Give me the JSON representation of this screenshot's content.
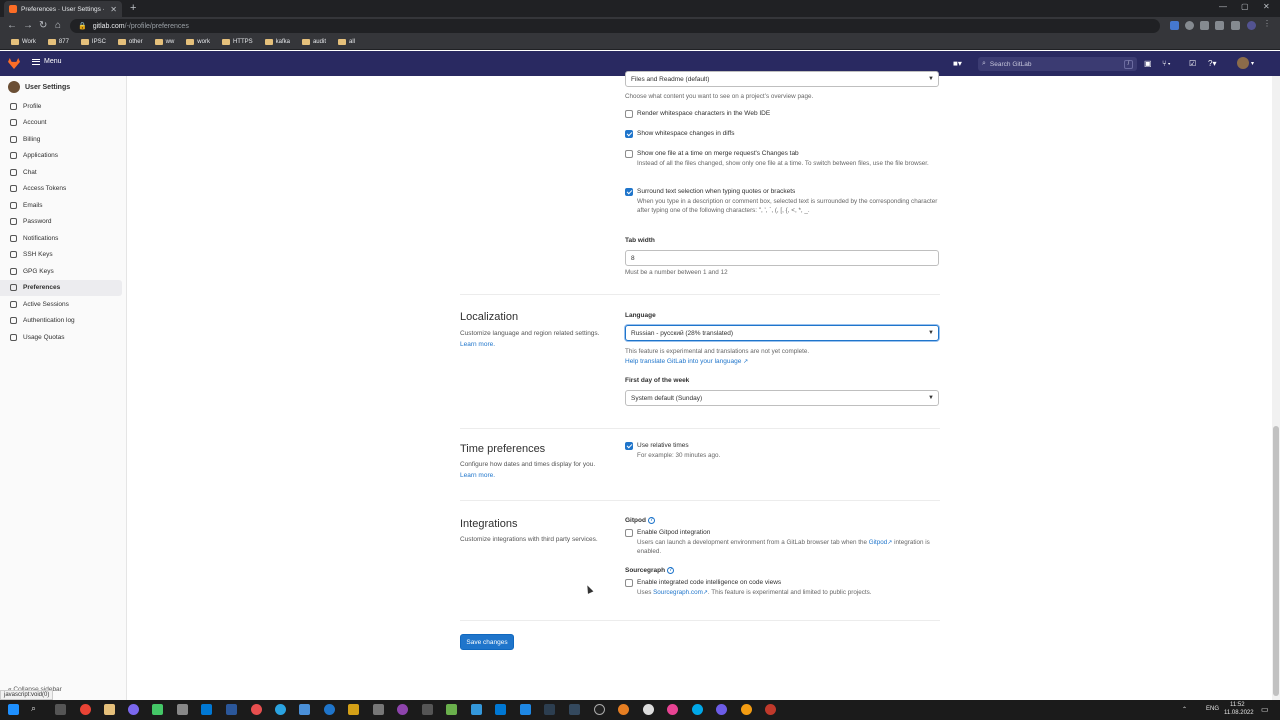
{
  "browser": {
    "tab_title": "Preferences · User Settings · GitL",
    "url_host": "gitlab.com",
    "url_path": "/-/profile/preferences",
    "bookmarks": [
      "Work",
      "877",
      "IPSC",
      "other",
      "ww",
      "work",
      "HTTPS",
      "kafka",
      "audit",
      "all"
    ]
  },
  "header": {
    "menu_label": "Menu",
    "search_placeholder": "Search GitLab",
    "search_shortcut": "/"
  },
  "sidebar": {
    "title": "User Settings",
    "items": [
      {
        "label": "Profile",
        "icon": "user-icon"
      },
      {
        "label": "Account",
        "icon": "account-icon"
      },
      {
        "label": "Billing",
        "icon": "credit-card-icon"
      },
      {
        "label": "Applications",
        "icon": "applications-icon"
      },
      {
        "label": "Chat",
        "icon": "chat-icon"
      },
      {
        "label": "Access Tokens",
        "icon": "token-icon"
      },
      {
        "label": "Emails",
        "icon": "mail-icon"
      },
      {
        "label": "Password",
        "icon": "lock-icon"
      },
      {
        "label": "Notifications",
        "icon": "notifications-icon"
      },
      {
        "label": "SSH Keys",
        "icon": "key-icon"
      },
      {
        "label": "GPG Keys",
        "icon": "key-icon"
      },
      {
        "label": "Preferences",
        "icon": "preferences-icon"
      },
      {
        "label": "Active Sessions",
        "icon": "monitor-icon"
      },
      {
        "label": "Authentication log",
        "icon": "log-icon"
      },
      {
        "label": "Usage Quotas",
        "icon": "quota-icon"
      }
    ],
    "active_index": 11,
    "collapse_label": "Collapse sidebar",
    "status_url": "javascript:void(0)"
  },
  "behavior": {
    "overview_select_value": "Files and Readme (default)",
    "overview_help": "Choose what content you want to see on a project’s overview page.",
    "render_whitespace_label": "Render whitespace characters in the Web IDE",
    "render_whitespace_checked": false,
    "show_whitespace_label": "Show whitespace changes in diffs",
    "show_whitespace_checked": true,
    "one_file_label": "Show one file at a time on merge request's Changes tab",
    "one_file_checked": false,
    "one_file_help": "Instead of all the files changed, show only one file at a time. To switch between files, use the file browser.",
    "surround_label": "Surround text selection when typing quotes or brackets",
    "surround_checked": true,
    "surround_help": "When you type in a description or comment box, selected text is surrounded by the corresponding character after typing one of the following characters: \", ', `, (, [, {, <, *, _.",
    "tab_width_label": "Tab width",
    "tab_width_value": "8",
    "tab_width_help": "Must be a number between 1 and 12"
  },
  "localization": {
    "title": "Localization",
    "desc": "Customize language and region related settings.",
    "learn_more": "Learn more.",
    "language_label": "Language",
    "language_value": "Russian - русский (28% translated)",
    "language_help": "This feature is experimental and translations are not yet complete.",
    "help_translate": "Help translate GitLab into your language",
    "first_day_label": "First day of the week",
    "first_day_value": "System default (Sunday)"
  },
  "time_preferences": {
    "title": "Time preferences",
    "desc": "Configure how dates and times display for you.",
    "learn_more": "Learn more.",
    "relative_label": "Use relative times",
    "relative_checked": true,
    "relative_help": "For example: 30 minutes ago."
  },
  "integrations": {
    "title": "Integrations",
    "desc": "Customize integrations with third party services.",
    "gitpod_label": "Gitpod",
    "gitpod_enable": "Enable Gitpod integration",
    "gitpod_checked": false,
    "gitpod_help_pre": "Users can launch a development environment from a GitLab browser tab when the",
    "gitpod_help_link": "Gitpod",
    "gitpod_help_post": "integration is enabled.",
    "sourcegraph_label": "Sourcegraph",
    "sourcegraph_enable": "Enable integrated code intelligence on code views",
    "sourcegraph_checked": false,
    "sourcegraph_help_pre": "Uses",
    "sourcegraph_help_link": "Sourcegraph.com",
    "sourcegraph_help_post": ". This feature is experimental and limited to public projects."
  },
  "save_label": "Save changes",
  "taskbar": {
    "lang": "ENG",
    "time": "11:52",
    "date": "11.08.2022"
  },
  "colors": {
    "header_bg": "#292961",
    "accent": "#1f75cb",
    "gitlab_orange": "#fc6d26"
  }
}
